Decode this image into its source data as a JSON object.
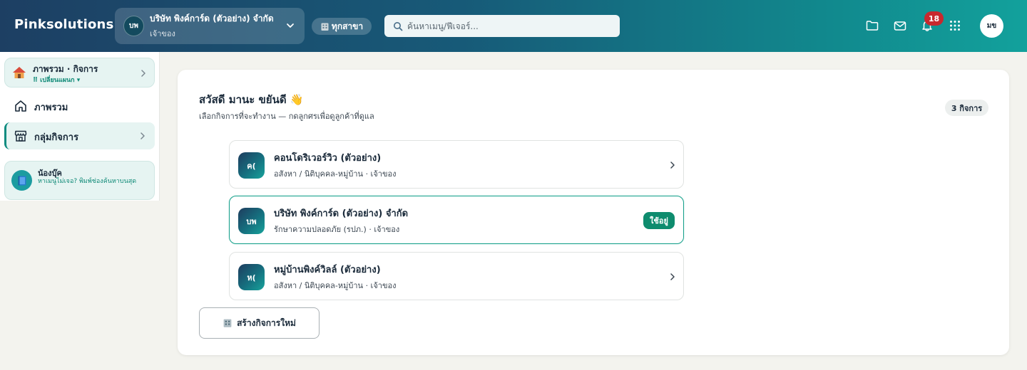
{
  "app": {
    "brand": "Pinksolutions"
  },
  "header": {
    "company": {
      "initials": "บพ",
      "name": "บริษัท พิงค์การ์ด (ตัวอย่าง) จำกัด",
      "role": "เจ้าของ"
    },
    "branch_label": "ทุกสาขา",
    "search_placeholder": "ค้นหาเมนู/ฟีเจอร์...",
    "notification_count": "18",
    "user_initials": "มข",
    "icons": [
      "folder-icon",
      "mail-icon",
      "bell-icon",
      "apps-grid-icon"
    ]
  },
  "sidebar": {
    "overview_card": {
      "title": "ภาพรวม · กิจการ",
      "switch_label": "⠿ เปลี่ยนแผนก ▾"
    },
    "items": [
      {
        "label": "ภาพรวม",
        "icon": "home-icon",
        "active": false
      },
      {
        "label": "กลุ่มกิจการ",
        "icon": "store-icon",
        "active": true
      }
    ],
    "help": {
      "title": "น้องบุ๊ค",
      "text": "หาเมนูไม่เจอ? พิมพ์ช่องค้นหาบนสุด"
    }
  },
  "main": {
    "greeting": "สวัสดี มานะ ขยันดี 👋",
    "subtitle": "เลือกกิจการที่จะทำงาน — กดลูกศรเพื่อดูลูกค้าที่ดูแล",
    "count_badge": "3 กิจการ",
    "businesses": [
      {
        "initials": "ค(",
        "name": "คอนโดริเวอร์วิว (ตัวอย่าง)",
        "meta": "อสังหา / นิติบุคคล-หมู่บ้าน · เจ้าของ",
        "active": false
      },
      {
        "initials": "บพ",
        "name": "บริษัท พิงค์การ์ด (ตัวอย่าง) จำกัด",
        "meta": "รักษาความปลอดภัย (รปภ.) · เจ้าของ",
        "active": true,
        "badge": "ใช้อยู่"
      },
      {
        "initials": "ห(",
        "name": "หมู่บ้านพิงค์วิลล์ (ตัวอย่าง)",
        "meta": "อสังหา / นิติบุคคล-หมู่บ้าน · เจ้าของ",
        "active": false
      }
    ],
    "create_button": "สร้างกิจการใหม่"
  },
  "colors": {
    "accent": "#0e8c80",
    "active_badge": "#0e8c6e",
    "notification": "#c8282e"
  }
}
